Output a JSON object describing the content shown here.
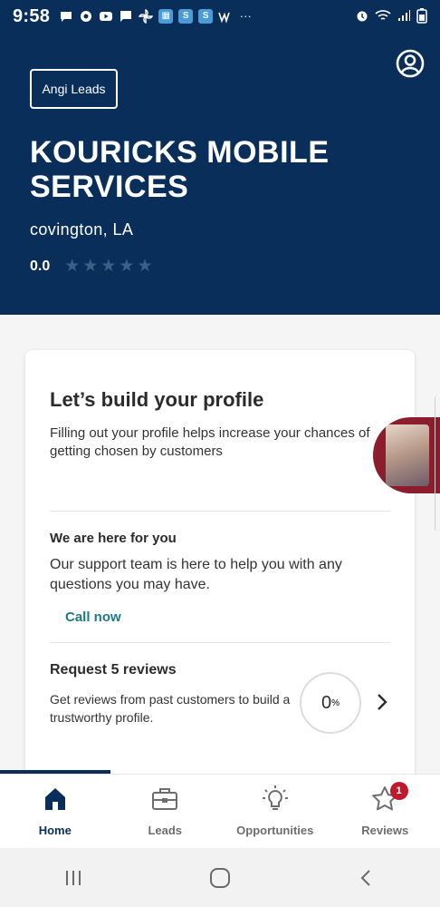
{
  "status_bar": {
    "time": "9:58",
    "left_icons": [
      "chat-icon",
      "settings-icon",
      "youtube-icon",
      "message-icon",
      "pinwheel-icon",
      "app-icon",
      "app-icon",
      "app-icon",
      "wordpress-icon",
      "more-icon"
    ],
    "right_icons": [
      "alarm-icon",
      "wifi-icon",
      "signal-icon",
      "battery-icon"
    ],
    "more_label": "···"
  },
  "header": {
    "brand_label": "Angi Leads",
    "company_name": "KOURICKS MOBILE SERVICES",
    "location": "covington, LA",
    "rating_value": "0.0",
    "rating_stars": 0,
    "max_stars": 5,
    "background_color": "#0a2e5a"
  },
  "card": {
    "title": "Let’s build your profile",
    "subtitle": "Filling out your profile helps increase your chances of getting chosen by customers",
    "support_title": "We are here for you",
    "support_text": "Our support team is here to help you with any questions you may have.",
    "call_now_label": "Call now",
    "reviews_title": "Request 5 reviews",
    "reviews_text": "Get reviews from past customers to build a trustworthy profile.",
    "progress_value": "0",
    "progress_unit": "%",
    "accent_color": "#1f7a86"
  },
  "bottom_nav": {
    "items": [
      {
        "label": "Home",
        "icon": "home-icon",
        "active": true
      },
      {
        "label": "Leads",
        "icon": "briefcase-icon",
        "active": false
      },
      {
        "label": "Opportunities",
        "icon": "lightbulb-icon",
        "active": false
      },
      {
        "label": "Reviews",
        "icon": "star-outline-icon",
        "active": false,
        "badge": "1"
      }
    ]
  },
  "system_nav": {
    "buttons": [
      "recent-apps-icon",
      "home-circle-icon",
      "back-icon"
    ]
  }
}
